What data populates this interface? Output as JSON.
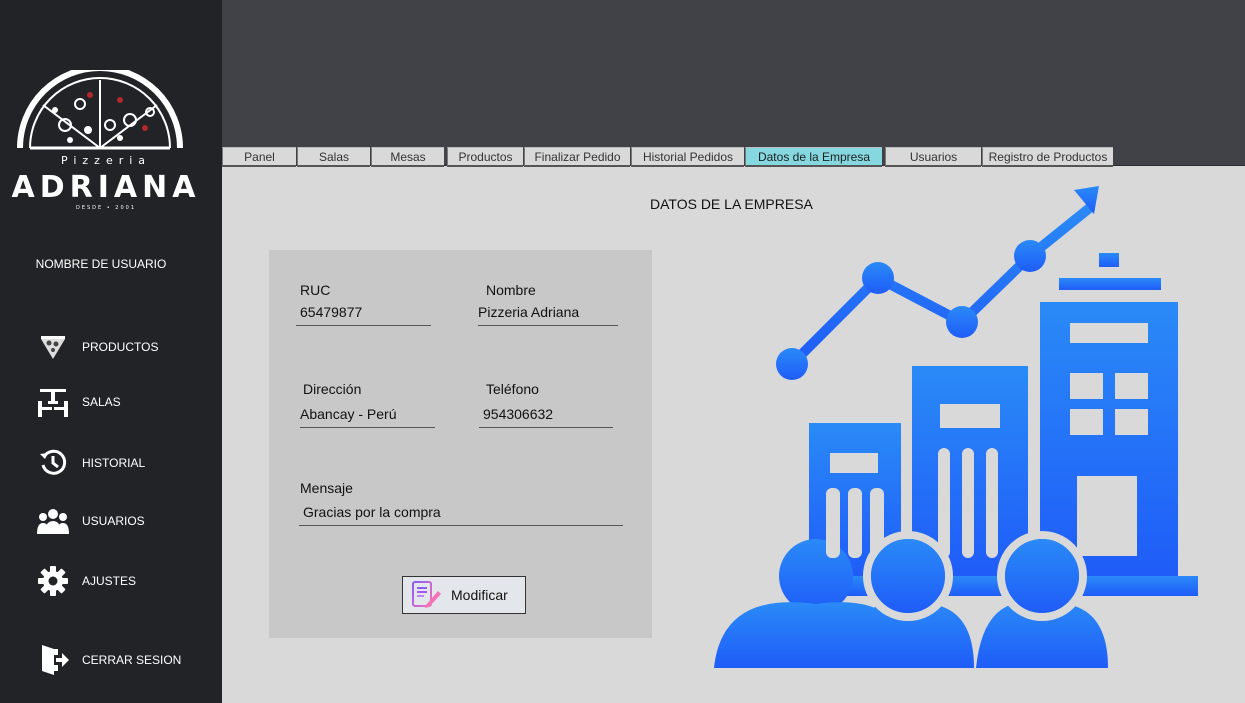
{
  "sidebar": {
    "logo": {
      "pizzeria": "Pizzeria",
      "brand": "ADRIANA",
      "since": "DESDE  •  2001"
    },
    "username": "NOMBRE DE USUARIO",
    "items": [
      {
        "label": "PRODUCTOS",
        "icon": "pizza-icon"
      },
      {
        "label": "SALAS",
        "icon": "table-chairs-icon"
      },
      {
        "label": "HISTORIAL",
        "icon": "history-icon"
      },
      {
        "label": "USUARIOS",
        "icon": "users-icon"
      },
      {
        "label": "AJUSTES",
        "icon": "gear-icon"
      },
      {
        "label": "CERRAR SESION",
        "icon": "logout-icon"
      }
    ]
  },
  "tabs": [
    {
      "label": "Panel"
    },
    {
      "label": "Salas"
    },
    {
      "label": "Mesas"
    },
    {
      "label": "Productos"
    },
    {
      "label": "Finalizar Pedido"
    },
    {
      "label": "Historial Pedidos"
    },
    {
      "label": "Datos de la Empresa",
      "active": true
    },
    {
      "label": "Usuarios"
    },
    {
      "label": "Registro de Productos"
    }
  ],
  "page": {
    "title": "DATOS DE LA EMPRESA"
  },
  "form": {
    "ruc": {
      "label": "RUC",
      "value": "65479877"
    },
    "nombre": {
      "label": "Nombre",
      "value": "Pizzeria Adriana"
    },
    "direccion": {
      "label": "Dirección",
      "value": "Abancay - Perú"
    },
    "telefono": {
      "label": "Teléfono",
      "value": "954306632"
    },
    "mensaje": {
      "label": "Mensaje",
      "value": "Gracias por la compra"
    },
    "modify_label": "Modificar"
  },
  "colors": {
    "sidebar_bg": "#212327",
    "topbar_bg": "#404247",
    "content_bg": "#d9d9d9",
    "panel_bg": "#c8c8c8",
    "active_tab": "#86d8e0",
    "illustration_blue": "#2a7bfa",
    "logo_red": "#b3282d"
  }
}
